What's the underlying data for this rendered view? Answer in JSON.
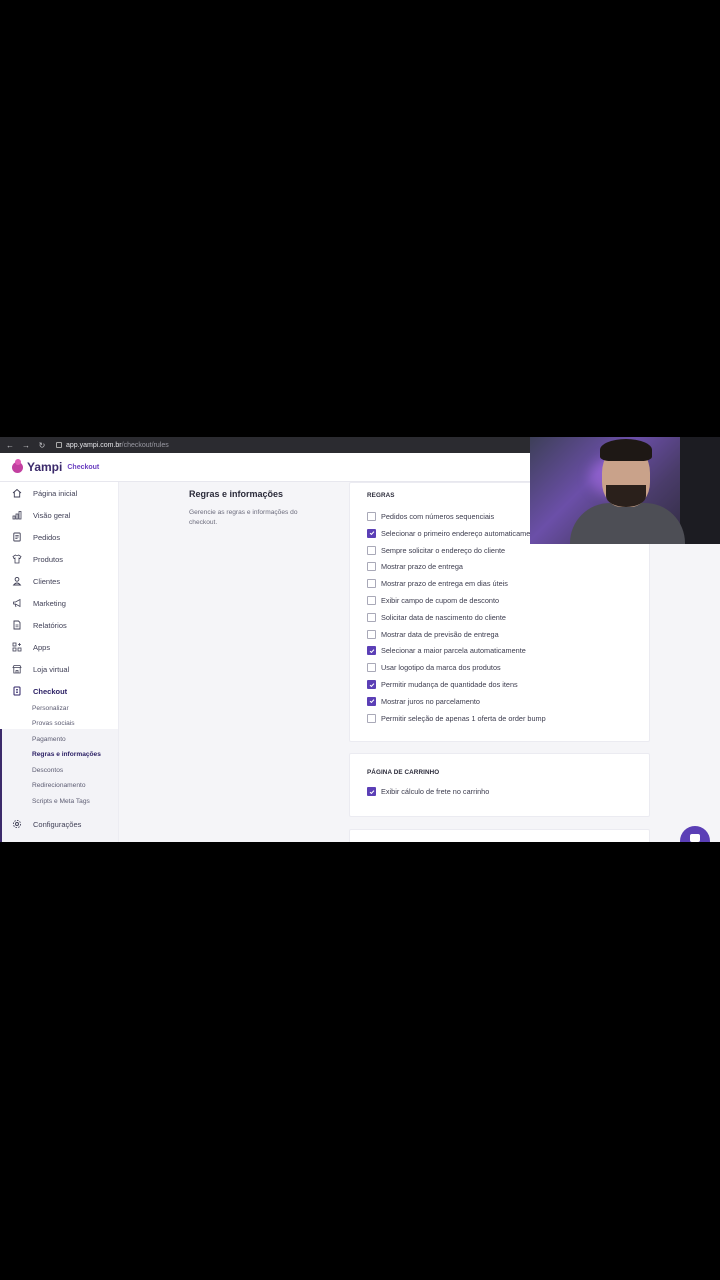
{
  "browser": {
    "url_host": "app.yampi.com.br",
    "url_path": "/checkout/rules"
  },
  "header": {
    "brand": "Yampi",
    "product": "Checkout"
  },
  "sidebar": {
    "items": [
      {
        "label": "Página inicial",
        "icon": "home-icon"
      },
      {
        "label": "Visão geral",
        "icon": "bar-chart-icon"
      },
      {
        "label": "Pedidos",
        "icon": "document-icon"
      },
      {
        "label": "Produtos",
        "icon": "shirt-icon"
      },
      {
        "label": "Clientes",
        "icon": "user-icon"
      },
      {
        "label": "Marketing",
        "icon": "megaphone-icon"
      },
      {
        "label": "Relatórios",
        "icon": "report-icon"
      },
      {
        "label": "Apps",
        "icon": "apps-icon"
      },
      {
        "label": "Loja virtual",
        "icon": "store-icon"
      },
      {
        "label": "Checkout",
        "icon": "checkout-icon"
      },
      {
        "label": "Configurações",
        "icon": "gear-icon"
      }
    ],
    "checkout_sub": [
      "Personalizar",
      "Provas sociais",
      "Pagamento",
      "Regras e informações",
      "Descontos",
      "Redirecionamento",
      "Scripts e Meta Tags"
    ],
    "active_sub": "Regras e informações"
  },
  "section": {
    "title": "Regras e informações",
    "description": "Gerencie as regras e informações do checkout."
  },
  "rules_card": {
    "title": "REGRAS",
    "items": [
      {
        "label": "Pedidos com números sequenciais",
        "checked": false
      },
      {
        "label": "Selecionar o primeiro endereço automaticamente",
        "checked": true
      },
      {
        "label": "Sempre solicitar o endereço do cliente",
        "checked": false
      },
      {
        "label": "Mostrar prazo de entrega",
        "checked": false
      },
      {
        "label": "Mostrar prazo de entrega em dias úteis",
        "checked": false
      },
      {
        "label": "Exibir campo de cupom de desconto",
        "checked": false
      },
      {
        "label": "Solicitar data de nascimento do cliente",
        "checked": false
      },
      {
        "label": "Mostrar data de previsão de entrega",
        "checked": false
      },
      {
        "label": "Selecionar a maior parcela automaticamente",
        "checked": true
      },
      {
        "label": "Usar logotipo da marca dos produtos",
        "checked": false
      },
      {
        "label": "Permitir mudança de quantidade dos itens",
        "checked": true
      },
      {
        "label": "Mostrar juros no parcelamento",
        "checked": true
      },
      {
        "label": "Permitir seleção de apenas 1 oferta de order bump",
        "checked": false
      }
    ]
  },
  "cart_card": {
    "title": "PÁGINA DE CARRINHO",
    "items": [
      {
        "label": "Exibir cálculo de frete no carrinho",
        "checked": true
      }
    ]
  },
  "colors": {
    "accent": "#5b3fb6",
    "brand": "#3b2a6b"
  }
}
